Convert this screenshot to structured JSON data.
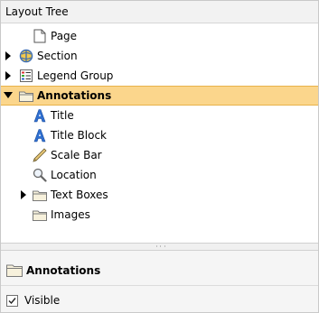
{
  "header": {
    "title": "Layout Tree"
  },
  "tree": {
    "items": [
      {
        "label": "Page",
        "icon": "page-icon"
      },
      {
        "label": "Section",
        "icon": "section-icon",
        "collapsed": true
      },
      {
        "label": "Legend Group",
        "icon": "legend-group-icon",
        "collapsed": true
      },
      {
        "label": "Annotations",
        "icon": "folder-icon",
        "expanded": true,
        "selected": true
      },
      {
        "label": "Title",
        "icon": "title-icon"
      },
      {
        "label": "Title Block",
        "icon": "title-block-icon"
      },
      {
        "label": "Scale Bar",
        "icon": "scale-bar-icon"
      },
      {
        "label": "Location",
        "icon": "location-icon"
      },
      {
        "label": "Text Boxes",
        "icon": "folder-icon",
        "collapsed": true
      },
      {
        "label": "Images",
        "icon": "folder-icon"
      }
    ]
  },
  "properties": {
    "title": "Annotations",
    "visible_label": "Visible",
    "visible_checked": true
  },
  "colors": {
    "selection": "#fbd68c",
    "selection_border": "#e8b24a",
    "folder": "#f1d27a"
  }
}
